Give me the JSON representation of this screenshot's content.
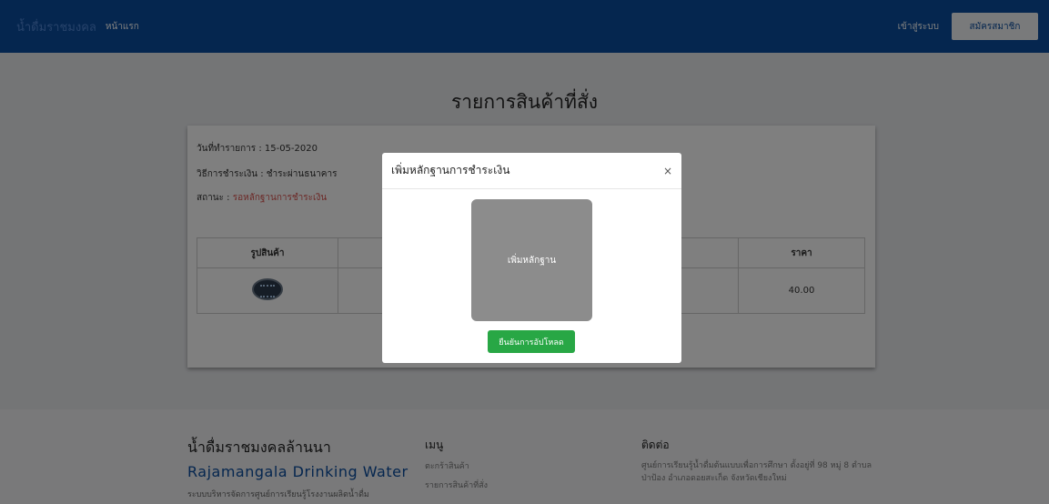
{
  "navbar": {
    "brand": "น้ำดื่มราชมงคล",
    "home": "หน้าแรก",
    "login": "เข้าสู่ระบบ",
    "register": "สมัครสมาชิก"
  },
  "page": {
    "title": "รายการสินค้าที่สั่ง"
  },
  "order": {
    "date": "วันที่ทำรายการ : 15-05-2020",
    "payment": "วิธีการชำระเงิน : ชำระผ่านธนาคาร",
    "status_label": "สถานะ : ",
    "status_value": "รอหลักฐานการชำระเงิน"
  },
  "table": {
    "headers": [
      "รูปสินค้า",
      "",
      "ราคา"
    ],
    "rows": [
      {
        "image": "water-bottle-pack-icon",
        "price": "40.00"
      }
    ]
  },
  "modal": {
    "title": "เพิ่มหลักฐานการชำระเงิน",
    "close": "×",
    "upload_label": "เพิ่มหลักฐาน",
    "confirm_label": "ยืนยันการอัปโหลด"
  },
  "footer": {
    "brand_th": "น้ำดื่มราชมงคลล้านนา",
    "brand_en": "Rajamangala Drinking Water",
    "tagline": "ระบบบริหารจัดการศูนย์การเรียนรู้โรงงานผลิตน้ำดื่ม",
    "menu_title": "เมนู",
    "menu_items": [
      "ตะกร้าสินค้า",
      "รายการสินค้าที่สั่ง"
    ],
    "contact_title": "ติดต่อ",
    "contact_text": "ศูนย์การเรียนรู้น้ำดื่มต้นแบบเพื่อการศึกษา ตั้งอยู่ที่ 98 หมู่ 8 ตำบลป่าป้อง อำเภอดอยสะเก็ด จังหวัดเชียงใหม่"
  },
  "colors": {
    "navbar": "#0a4c9e",
    "confirm_button": "#28a745",
    "status": "#d9534f"
  }
}
